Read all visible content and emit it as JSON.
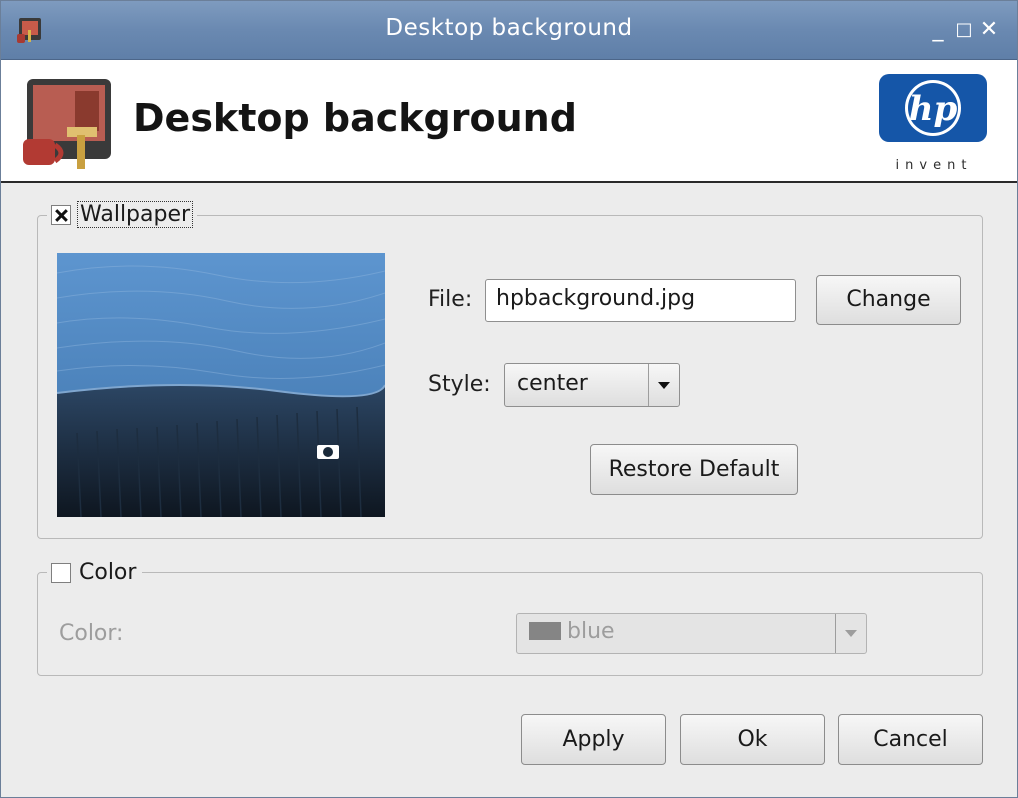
{
  "window": {
    "title": "Desktop background",
    "controls": {
      "minimize": "_",
      "maximize": "□",
      "close": "✕"
    }
  },
  "header": {
    "title": "Desktop background",
    "logo": {
      "text": "hp",
      "tagline": "invent"
    }
  },
  "wallpaper": {
    "legend": "Wallpaper",
    "enabled": true,
    "file_label": "File:",
    "file_value": "hpbackground.jpg",
    "change_label": "Change",
    "style_label": "Style:",
    "style_value": "center",
    "restore_label": "Restore Default"
  },
  "color_group": {
    "legend": "Color",
    "enabled": false,
    "color_label": "Color:",
    "color_value": "blue"
  },
  "footer": {
    "apply_label": "Apply",
    "ok_label": "Ok",
    "cancel_label": "Cancel"
  },
  "colors": {
    "titlebar": "#6a89b1",
    "hp_blue": "#1556a8",
    "window_bg": "#ececec",
    "disabled_text": "#9d9d9d"
  },
  "icons": [
    "app-icon",
    "desktop-background-icon",
    "hp-logo",
    "chevron-down-icon",
    "checkbox-checked-icon"
  ]
}
